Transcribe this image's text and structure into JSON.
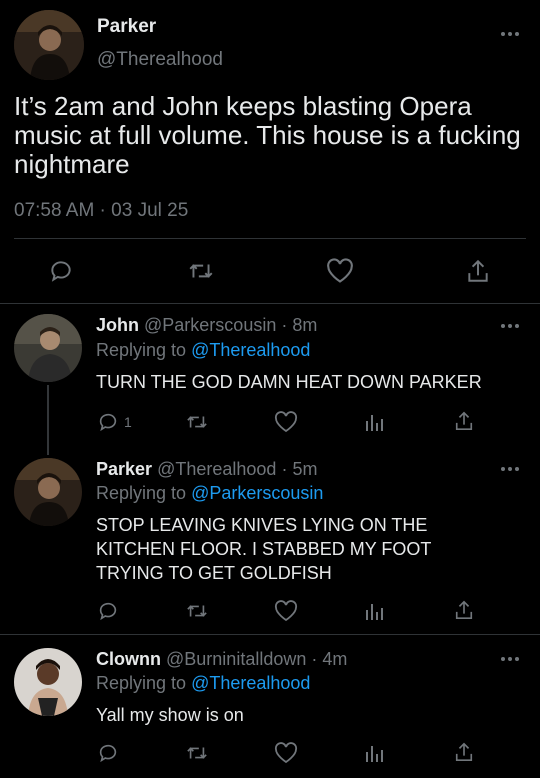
{
  "main_tweet": {
    "name": "Parker",
    "handle": "@Therealhood",
    "text": "It’s 2am and John keeps blasting Opera music at full volume. This house is a fucking nightmare",
    "timestamp": "07:58 AM · 03 Jul 25"
  },
  "replies": [
    {
      "name": "John",
      "handle": "@Parkerscousin",
      "time": "· 8m",
      "replying_label": "Replying to",
      "replying_to": "@Therealhood",
      "text": "TURN THE GOD DAMN HEAT DOWN PARKER",
      "reply_count": "1"
    },
    {
      "name": "Parker",
      "handle": "@Therealhood",
      "time": "· 5m",
      "replying_label": "Replying to",
      "replying_to": "@Parkerscousin",
      "text": "STOP LEAVING KNIVES LYING ON THE KITCHEN FLOOR. I STABBED MY FOOT TRYING TO GET GOLDFISH"
    },
    {
      "name": "Clownn",
      "handle": "@Burninitalldown",
      "time": "· 4m",
      "replying_label": "Replying to",
      "replying_to": "@Therealhood",
      "text": "Yall my show is on"
    }
  ],
  "icons": [
    "reply-icon",
    "retweet-icon",
    "like-icon",
    "share-icon",
    "analytics-icon",
    "more-icon"
  ],
  "colors": {
    "background": "#000000",
    "text": "#e7e9ea",
    "muted": "#71767b",
    "link": "#1d9bf0",
    "divider": "#2f3336"
  }
}
